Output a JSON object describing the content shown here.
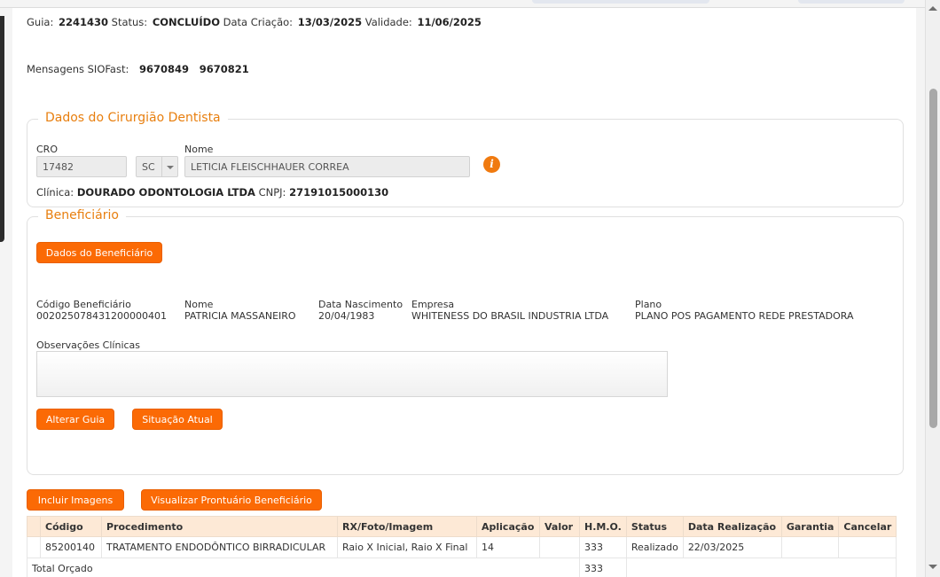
{
  "header": {
    "guia_label": "Guia:",
    "guia_value": "2241430",
    "status_label": "Status:",
    "status_value": "CONCLUÍDO",
    "data_criacao_label": "Data Criação:",
    "data_criacao_value": "13/03/2025",
    "validade_label": "Validade:",
    "validade_value": "11/06/2025",
    "mensagens_label": "Mensagens SIOFast:",
    "mensagens": [
      "9670849",
      "9670821"
    ]
  },
  "dentista": {
    "legend": "Dados do Cirurgião Dentista",
    "cro_label": "CRO",
    "cro_value": "17482",
    "uf_value": "SC",
    "nome_label": "Nome",
    "nome_value": "LETICIA FLEISCHHAUER CORREA",
    "clinica_label": "Clínica:",
    "clinica_value": "DOURADO ODONTOLOGIA LTDA",
    "cnpj_label": "CNPJ:",
    "cnpj_value": "27191015000130",
    "info_icon": "i"
  },
  "beneficiario": {
    "legend": "Beneficiário",
    "dados_button": "Dados do Beneficiário",
    "fields": {
      "codigo_label": "Código Beneficiário",
      "codigo_value": "002025078431200000401",
      "nome_label": "Nome",
      "nome_value": "PATRICIA MASSANEIRO",
      "nascimento_label": "Data Nascimento",
      "nascimento_value": "20/04/1983",
      "empresa_label": "Empresa",
      "empresa_value": "WHITENESS DO BRASIL INDUSTRIA LTDA",
      "plano_label": "Plano",
      "plano_value": "PLANO POS PAGAMENTO REDE PRESTADORA"
    },
    "observacoes_label": "Observações Clínicas",
    "observacoes_value": "",
    "alterar_button": "Alterar Guia",
    "situacao_button": "Situação Atual"
  },
  "actions": {
    "incluir_imagens": "Incluir Imagens",
    "visualizar_prontuario": "Visualizar Prontuário Beneficiário"
  },
  "procedimentos": {
    "columns": [
      "",
      "Código",
      "Procedimento",
      "RX/Foto/Imagem",
      "Aplicação",
      "Valor",
      "H.M.O.",
      "Status",
      "Data Realização",
      "Garantia",
      "Cancelar"
    ],
    "rows": [
      [
        "",
        "85200140",
        "TRATAMENTO ENDODÔNTICO BIRRADICULAR",
        "Raio X Inicial, Raio X Final",
        "14",
        "",
        "333",
        "Realizado",
        "22/03/2025",
        "",
        ""
      ]
    ],
    "total_label": "Total Orçado",
    "total_hmo": "333"
  },
  "colors": {
    "accent": "#fb6a05",
    "legend": "#e87f0f",
    "table_header": "#fde9d6"
  }
}
